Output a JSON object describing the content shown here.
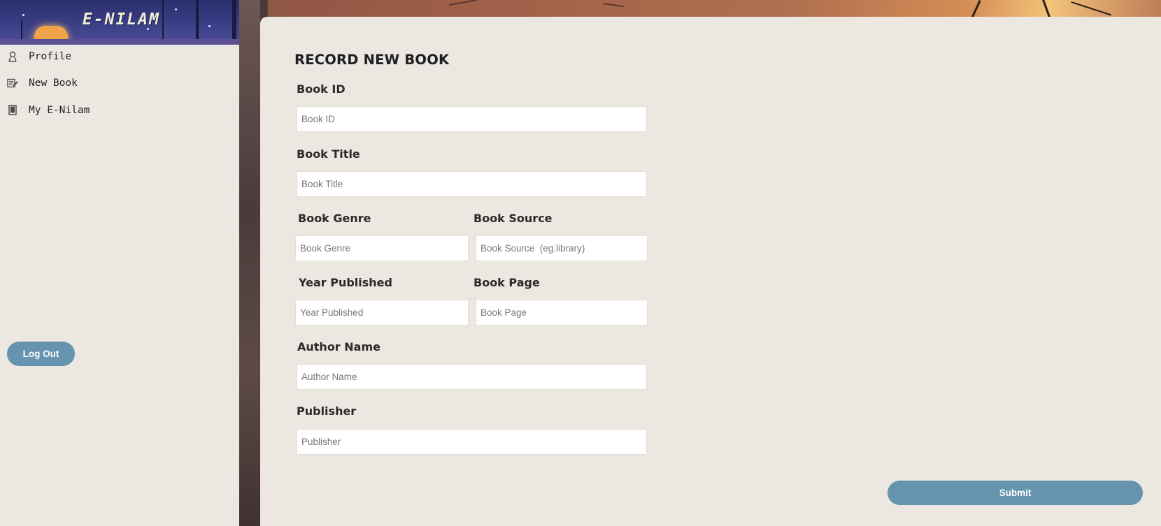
{
  "app": {
    "brand": "E-NILAM"
  },
  "sidebar": {
    "items": [
      {
        "label": "Profile",
        "icon": "user-icon"
      },
      {
        "label": "New Book",
        "icon": "edit-book-icon"
      },
      {
        "label": "My E-Nilam",
        "icon": "book-icon"
      }
    ],
    "logout_label": "Log Out"
  },
  "form": {
    "title": "RECORD NEW BOOK",
    "book_id": {
      "label": "Book ID",
      "placeholder": "Book ID",
      "value": ""
    },
    "book_title": {
      "label": "Book Title",
      "placeholder": "Book Title",
      "value": ""
    },
    "book_genre": {
      "label": "Book Genre",
      "placeholder": "Book Genre",
      "value": ""
    },
    "book_source": {
      "label": "Book Source",
      "placeholder": "Book Source  (eg.library)",
      "value": ""
    },
    "year_published": {
      "label": "Year Published",
      "placeholder": "Year Published",
      "value": ""
    },
    "book_page": {
      "label": "Book Page",
      "placeholder": "Book Page",
      "value": ""
    },
    "author_name": {
      "label": "Author Name",
      "placeholder": "Author Name",
      "value": ""
    },
    "publisher": {
      "label": "Publisher",
      "placeholder": "Publisher",
      "value": ""
    },
    "submit_label": "Submit"
  },
  "colors": {
    "accent": "#6693ad",
    "panel": "#ece7e1",
    "banner": "#3a3f86"
  }
}
